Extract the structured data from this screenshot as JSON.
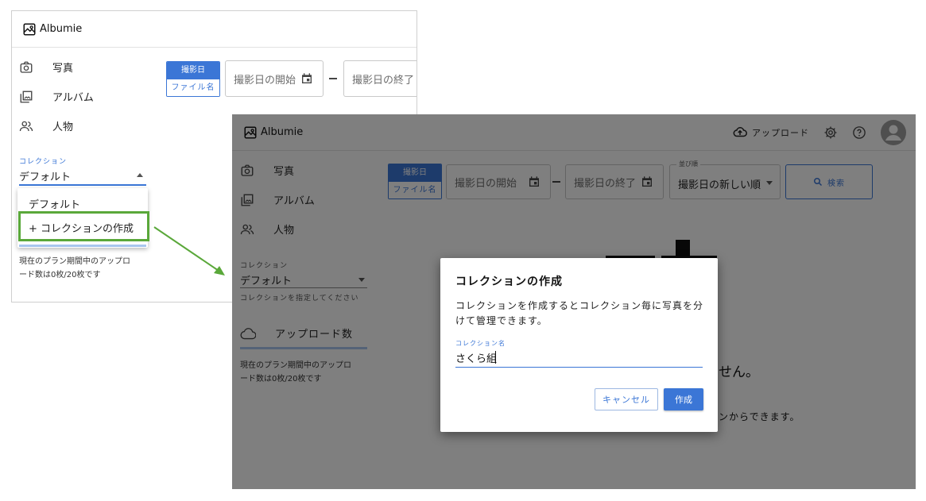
{
  "app": {
    "name": "Albumie"
  },
  "nav": {
    "photos": "写真",
    "albums": "アルバム",
    "people": "人物"
  },
  "collection": {
    "label": "コレクション",
    "value": "デフォルト",
    "helper": "コレクションを指定してください",
    "options": [
      "デフォルト",
      "+ コレクションの作成"
    ]
  },
  "plan_note": {
    "line1": "現在のプラン期間中のアップロ",
    "line2": "ード数は0枚/20枚です"
  },
  "upload_count_label": "アップロード数",
  "filter": {
    "toggle_active": "撮影日",
    "toggle_inactive": "ファイル名",
    "date_start_placeholder": "撮影日の開始",
    "date_end_placeholder": "撮影日の終了",
    "sort_label": "並び順",
    "sort_value": "撮影日の新しい順",
    "search_label": "検索"
  },
  "header": {
    "upload_label": "アップロード"
  },
  "empty_state": {
    "line1_fragment": "せん。",
    "line2_fragment": "ンからできます。"
  },
  "dialog": {
    "title": "コレクションの作成",
    "description": "コレクションを作成するとコレクション毎に写真を分けて管理できます。",
    "field_label": "コレクション名",
    "field_value": "さくら組",
    "cancel_label": "キャンセル",
    "create_label": "作成"
  },
  "colors": {
    "accent": "#3b76d6",
    "highlight": "#5aa83a",
    "scrim": "rgba(0,0,0,0.5)"
  }
}
